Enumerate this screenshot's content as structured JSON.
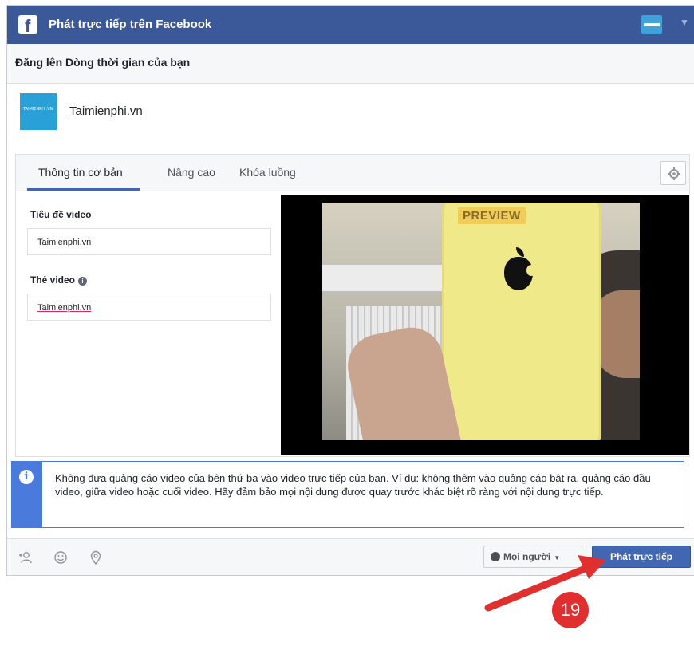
{
  "window": {
    "title": "Phát trực tiếp trên Facebook",
    "subtitle": "Đăng lên Dòng thời gian của bạn"
  },
  "page": {
    "name": "Taimienphi.vn",
    "avatar_text": "TAIMIENPHI.VN"
  },
  "tabs": [
    {
      "label": "Thông tin cơ bản",
      "active": true
    },
    {
      "label": "Nâng cao",
      "active": false
    },
    {
      "label": "Khóa luồng",
      "active": false
    }
  ],
  "form": {
    "title_label": "Tiêu đề video",
    "title_value": "Taimienphi.vn",
    "tags_label": "Thẻ video",
    "tags_value": "Taimienphi.vn"
  },
  "preview": {
    "badge": "PREVIEW"
  },
  "notice": {
    "text": "Không đưa quảng cáo video của bên thứ ba vào video trực tiếp của bạn. Ví dụ: không thêm vào quảng cáo bật ra, quảng cáo đầu video, giữa video hoặc cuối video. Hãy đảm bảo mọi nội dung được quay trước khác biệt rõ ràng với nội dung trực tiếp."
  },
  "footer": {
    "icons": [
      "tag-people-icon",
      "feeling-icon",
      "location-icon"
    ],
    "audience_label": "Mọi người",
    "go_live_label": "Phát trực tiếp"
  },
  "annotation": {
    "step_number": "19"
  },
  "colors": {
    "brand": "#3b5998",
    "button": "#4267b2",
    "notice_accent": "#4a7bdc",
    "annotation": "#e02f2f"
  }
}
